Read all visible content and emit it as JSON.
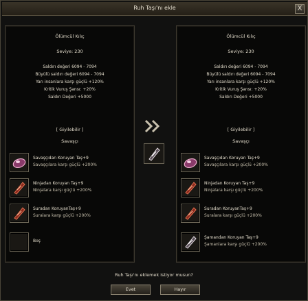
{
  "window": {
    "title": "Ruh Taşı'nı ekle",
    "close_glyph": "X"
  },
  "left_panel": {
    "item_name": "Ölümcül Kılıç",
    "level": "Seviye: 230",
    "stats": [
      "Saldırı değeri 6094 - 7094",
      "Büyülü saldırı değeri 6094 - 7094",
      "Yarı insanlara karşı güçlü +120%",
      "Kritik Vuruş Şansı: +20%",
      "Saldırı Değeri +5000"
    ],
    "wearable": "[ Giyilebilir ]",
    "class": "Savaşçı",
    "slots": [
      {
        "icon": "purple-soulstone-icon",
        "title": "Savaşçıdan Koruyan Taş+9",
        "desc": "Savaşçılara karşı güçlü +200%"
      },
      {
        "icon": "red-soulstone-icon",
        "title": "Ninjadan Koruyan Taş+9",
        "desc": "Ninjalara karşı güçlü +200%"
      },
      {
        "icon": "red-soulstone-icon",
        "title": "Suradan KoruyanTaş+9",
        "desc": "Suralara karşı güçlü +200%"
      },
      {
        "icon": "empty-slot",
        "title": "Boş",
        "desc": ""
      }
    ]
  },
  "right_panel": {
    "item_name": "Ölümcül Kılıç",
    "level": "Seviye: 230",
    "stats": [
      "Saldırı değeri 6094 - 7094",
      "Büyülü saldırı değeri 6094 - 7094",
      "Yarı insanlara karşı güçlü +120%",
      "Kritik Vuruş Şansı: +20%",
      "Saldırı Değeri +5000"
    ],
    "wearable": "[ Giyilebilir ]",
    "class": "Savaşçı",
    "slots": [
      {
        "icon": "purple-soulstone-icon",
        "title": "Savaşçıdan Koruyan Taş+9",
        "desc": "Savaşçılara karşı güçlü +200%"
      },
      {
        "icon": "red-soulstone-icon",
        "title": "Ninjadan Koruyan Taş+9",
        "desc": "Ninjalara karşı güçlü +200%"
      },
      {
        "icon": "red-soulstone-icon",
        "title": "Suradan KoruyanTaş+9",
        "desc": "Suralara karşı güçlü +200%"
      },
      {
        "icon": "white-soulstone-icon",
        "title": "Şamandan Koruyan Taş+9",
        "desc": "Şamanlara karşı güçlü +200%"
      }
    ]
  },
  "center": {
    "arrow_icon": "double-chevron-right-icon",
    "stone_icon": "white-soulstone-icon"
  },
  "prompt": {
    "question": "Ruh Taşı'nı eklemek istiyor musun?",
    "yes_label": "Evet",
    "no_label": "Hayır"
  },
  "colors": {
    "purple_stone": "#c86a9a",
    "red_stone": "#b0402e",
    "white_stone": "#d8d0d4"
  }
}
